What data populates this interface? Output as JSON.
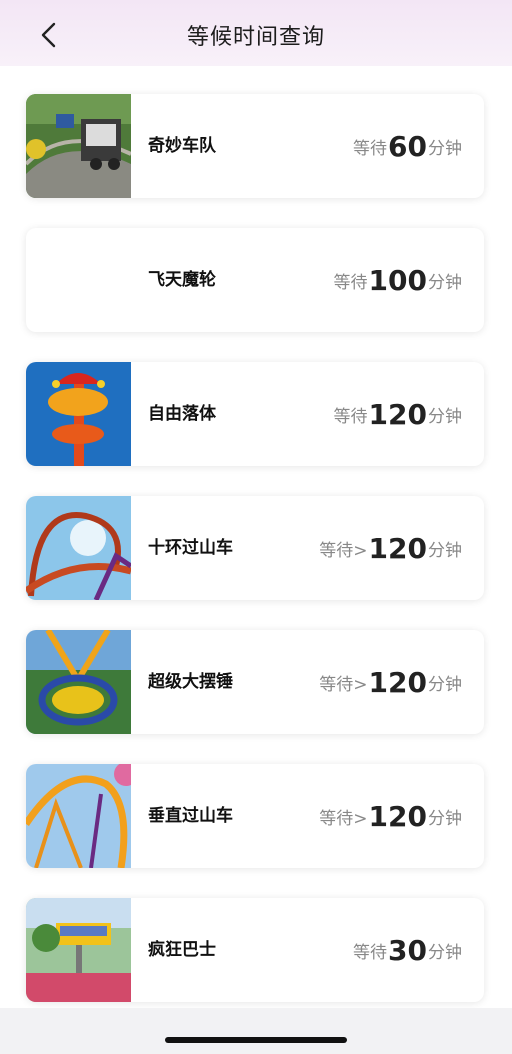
{
  "header": {
    "title": "等候时间查询"
  },
  "rides": [
    {
      "name": "奇妙车队",
      "prefix": "等待",
      "minutes": "60",
      "suffix": "分钟"
    },
    {
      "name": "飞天魔轮",
      "prefix": "等待",
      "minutes": "100",
      "suffix": "分钟"
    },
    {
      "name": "自由落体",
      "prefix": "等待",
      "minutes": "120",
      "suffix": "分钟"
    },
    {
      "name": "十环过山车",
      "prefix": "等待>",
      "minutes": "120",
      "suffix": "分钟"
    },
    {
      "name": "超级大摆锤",
      "prefix": "等待>",
      "minutes": "120",
      "suffix": "分钟"
    },
    {
      "name": "垂直过山车",
      "prefix": "等待>",
      "minutes": "120",
      "suffix": "分钟"
    },
    {
      "name": "疯狂巴士",
      "prefix": "等待",
      "minutes": "30",
      "suffix": "分钟"
    }
  ]
}
